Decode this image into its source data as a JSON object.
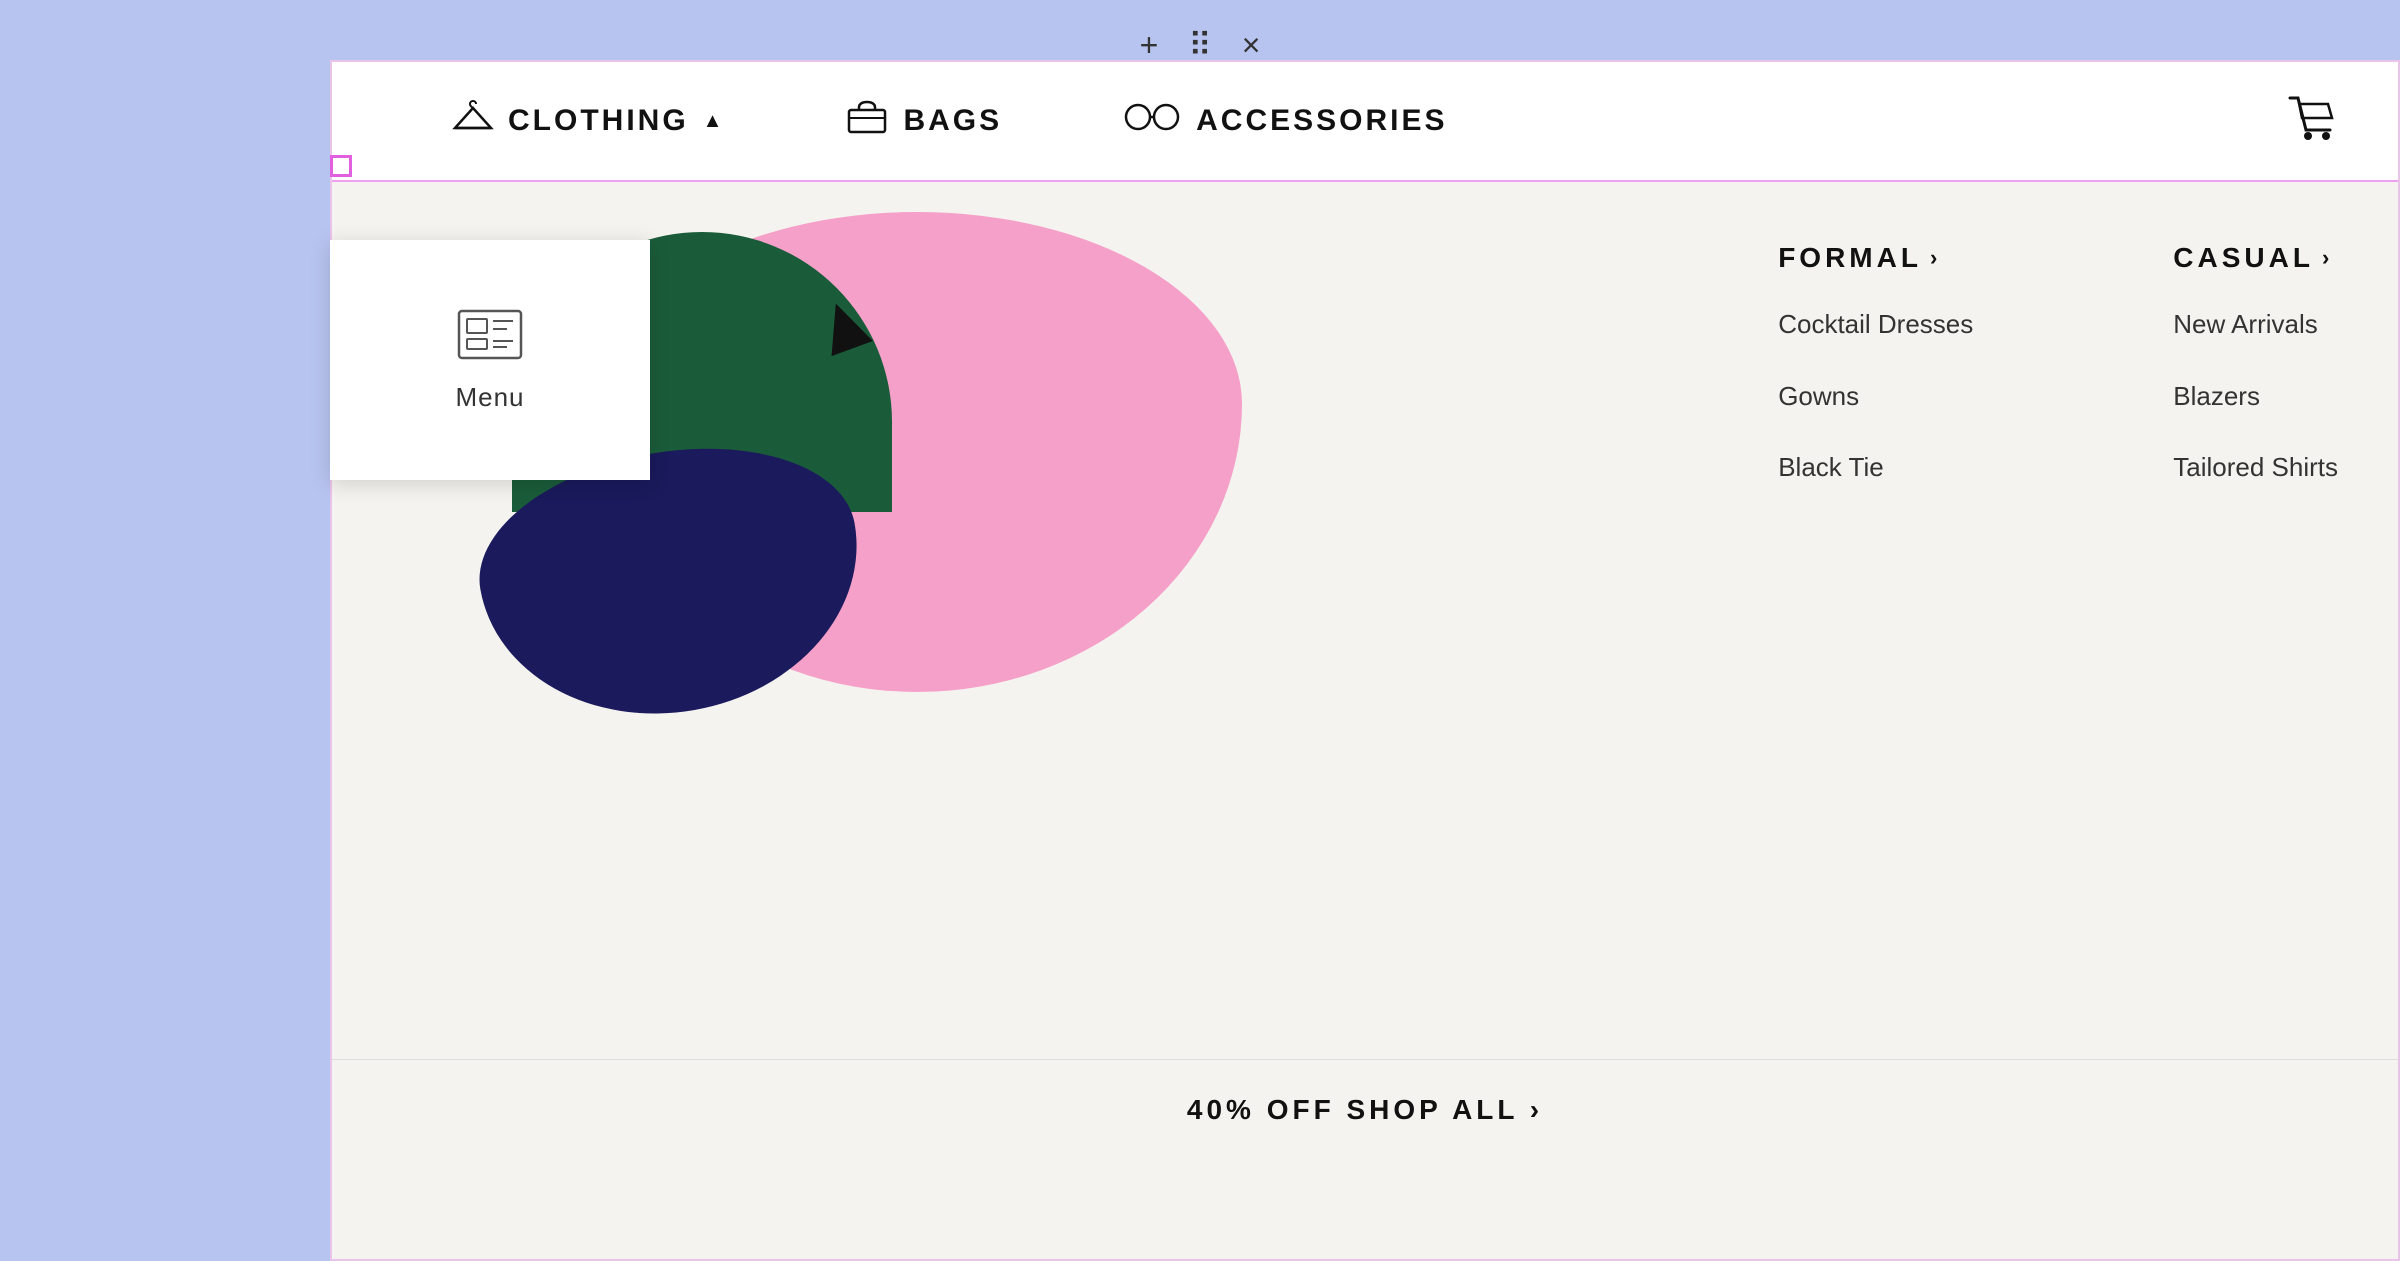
{
  "browser": {
    "chrome_icons": [
      "plus",
      "grid",
      "close"
    ],
    "plus_symbol": "+",
    "grid_symbol": "⠿",
    "close_symbol": "×"
  },
  "navbar": {
    "clothing_label": "CLOTHING",
    "bags_label": "BAGS",
    "accessories_label": "ACCESSORIES"
  },
  "formal_column": {
    "header": "FORMAL",
    "chevron": "›",
    "items": [
      "Cocktail Dresses",
      "Gowns",
      "Black Tie"
    ]
  },
  "casual_column": {
    "header": "CASUAL",
    "chevron": "›",
    "items": [
      "New Arrivals",
      "Blazers",
      "Tailored Shirts"
    ]
  },
  "promo": {
    "label": "40% OFF SHOP ALL ›"
  },
  "tooltip": {
    "label": "Menu"
  }
}
